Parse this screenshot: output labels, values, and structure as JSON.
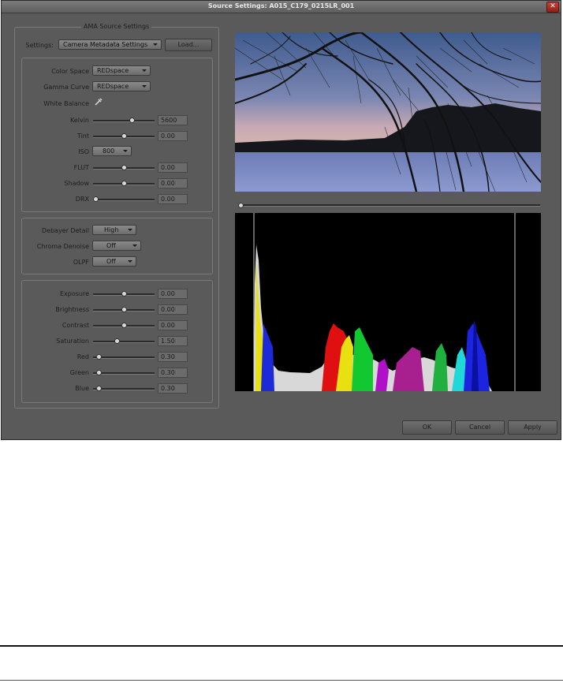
{
  "window": {
    "title": "Source Settings: A015_C179_0215LR_001",
    "close_symbol": "✕"
  },
  "ama": {
    "legend": "AMA Source Settings",
    "settings_label": "Settings:",
    "settings_value": "Camera Metadata Settings",
    "load_button": "Load..."
  },
  "color": {
    "color_space_label": "Color Space",
    "color_space_value": "REDspace",
    "gamma_curve_label": "Gamma Curve",
    "gamma_curve_value": "REDspace",
    "white_balance_label": "White Balance",
    "iso_label": "ISO",
    "iso_value": "800",
    "sliders": [
      {
        "label": "Kelvin",
        "value": "5600",
        "level": 0.65
      },
      {
        "label": "Tint",
        "value": "0.00",
        "level": 0.5
      },
      {
        "label": "FLUT",
        "value": "0.00",
        "level": 0.5
      },
      {
        "label": "Shadow",
        "value": "0.00",
        "level": 0.5
      },
      {
        "label": "DRX",
        "value": "0.00",
        "level": 0.0
      }
    ]
  },
  "debayer": {
    "detail_label": "Debayer Detail",
    "detail_value": "High",
    "denoise_label": "Chroma Denoise",
    "denoise_value": "Off",
    "olpf_label": "OLPF",
    "olpf_value": "Off"
  },
  "image": {
    "sliders": [
      {
        "label": "Exposure",
        "value": "0.00",
        "level": 0.5
      },
      {
        "label": "Brightness",
        "value": "0.00",
        "level": 0.5
      },
      {
        "label": "Contrast",
        "value": "0.00",
        "level": 0.5
      },
      {
        "label": "Saturation",
        "value": "1.50",
        "level": 0.38
      },
      {
        "label": "Red",
        "value": "0.30",
        "level": 0.05
      },
      {
        "label": "Green",
        "value": "0.30",
        "level": 0.05
      },
      {
        "label": "Blue",
        "value": "0.30",
        "level": 0.05
      }
    ]
  },
  "timeline": {
    "position": 0.0
  },
  "footer": {
    "ok": "OK",
    "cancel": "Cancel",
    "apply": "Apply"
  },
  "colors": {
    "dialog_bg": "#5a5a5a",
    "histogram_bg": "#000000",
    "close_red": "#b0352d"
  }
}
